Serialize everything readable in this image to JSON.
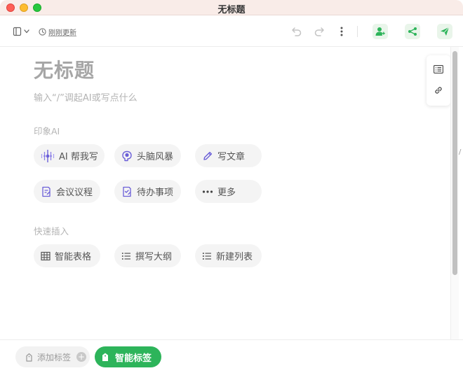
{
  "window": {
    "title": "无标题"
  },
  "toolbar": {
    "updated_label": "刚刚更新"
  },
  "doc": {
    "title": "无标题",
    "hint": "输入“/”调起AI或写点什么"
  },
  "ai_section": {
    "label": "印象AI",
    "chips": [
      {
        "label": "AI 帮我写",
        "icon": "sparkle-icon"
      },
      {
        "label": "头脑风暴",
        "icon": "brain-icon"
      },
      {
        "label": "写文章",
        "icon": "pencil-icon"
      },
      {
        "label": "会议议程",
        "icon": "agenda-icon"
      },
      {
        "label": "待办事项",
        "icon": "todo-icon"
      },
      {
        "label": "更多",
        "icon": "more-horizontal-icon"
      }
    ]
  },
  "quick_section": {
    "label": "快速插入",
    "chips": [
      {
        "label": "智能表格",
        "icon": "table-icon"
      },
      {
        "label": "撰写大纲",
        "icon": "bullet-list-icon"
      },
      {
        "label": "新建列表",
        "icon": "numbered-list-icon"
      }
    ]
  },
  "bottom": {
    "add_tag_label": "添加标签",
    "smart_tag_label": "智能标签"
  },
  "colors": {
    "accent_green": "#2db45a",
    "ai_icon_purple": "#6b5fd8"
  }
}
